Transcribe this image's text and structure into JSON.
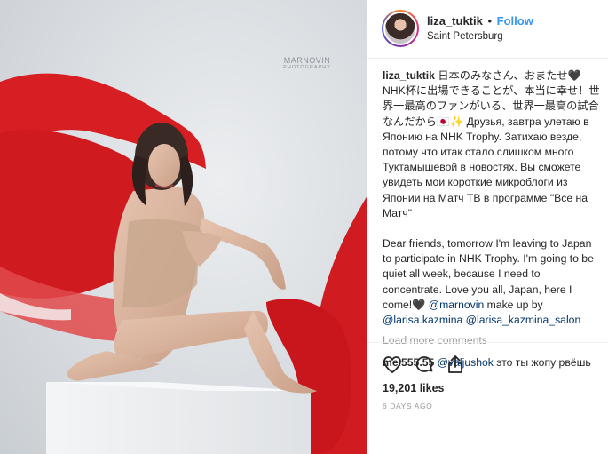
{
  "post": {
    "watermark": {
      "main": "MARNOVIN",
      "sub": "PHOTOGRAPHY"
    },
    "header": {
      "username": "liza_tuktik",
      "separator": "•",
      "follow_label": "Follow",
      "location": "Saint Petersburg"
    },
    "caption": {
      "username": "liza_tuktik",
      "text_ru": " 日本のみなさん、おまたせ🖤 NHK杯に出場できることが、本当に幸せ！世界一最高のファンがいる、世界一最高の試合なんだから🇯🇵✨ Друзья, завтра улетаю в Японию на NHK Trophy. Затихаю везде, потому что итак стало слишком много Туктамышевой в новостях. Вы сможете увидеть мои короткие микроблоги из Японии на Матч ТВ в программе \"Все на Матч\"",
      "text_en": "Dear friends, tomorrow I'm leaving to Japan to participate in NHK Trophy. I'm going to be quiet all week, because I need to concentrate. Love you all, Japan, here I come!🖤 ",
      "mention_1": "@marnovin",
      "text_makeup": " make up by ",
      "mention_2": "@larisa.kazmina",
      "mention_3": "@larisa_kazmina_salon"
    },
    "load_more": "Load more comments",
    "comment": {
      "username": "me.555.55",
      "mention": "@valjushok",
      "text": " это ты жопу рвёшь"
    },
    "icons": [
      "heart-icon",
      "comment-icon",
      "share-icon"
    ],
    "likes": "19,201 likes",
    "time": "6 DAYS AGO"
  }
}
